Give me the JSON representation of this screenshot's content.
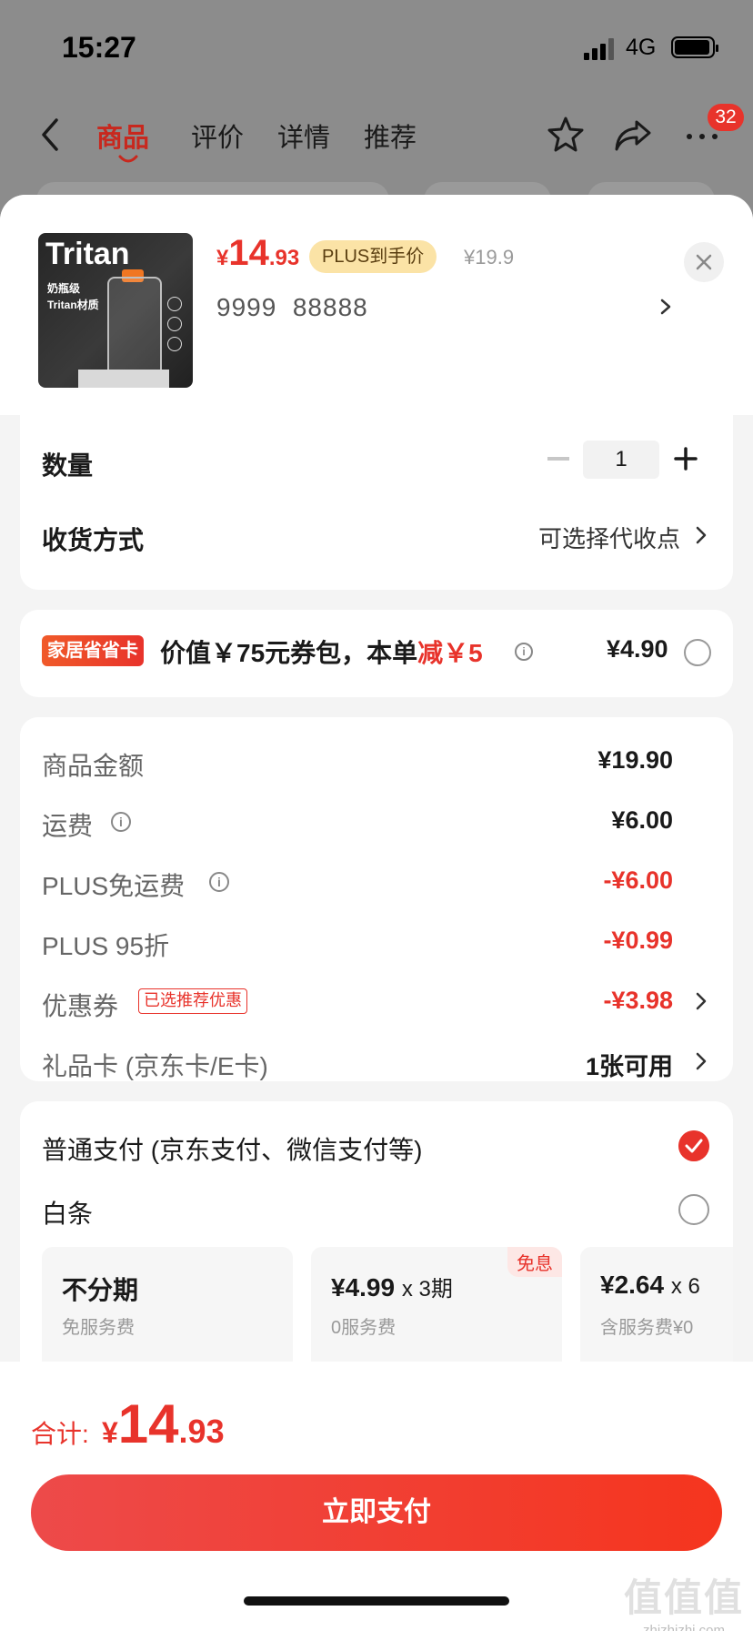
{
  "status_bar": {
    "time": "15:27",
    "network": "4G"
  },
  "nav": {
    "tabs": [
      {
        "label": "商品",
        "active": true
      },
      {
        "label": "评价",
        "active": false
      },
      {
        "label": "详情",
        "active": false
      },
      {
        "label": "推荐",
        "active": false
      }
    ],
    "icons": [
      "back-icon",
      "star-icon",
      "share-icon",
      "more-icon"
    ],
    "badge": "32"
  },
  "product": {
    "thumb_brand": "Tritan",
    "thumb_line1": "奶瓶级",
    "thumb_line2": "Tritan材质",
    "price_currency": "¥",
    "price_int": "14",
    "price_dec": ".93",
    "plus_tag": "PLUS到手价",
    "original_price": "¥19.9",
    "spec": "9999  88888"
  },
  "quantity": {
    "label": "数量",
    "value": "1"
  },
  "delivery": {
    "label": "收货方式",
    "value": "可选择代收点"
  },
  "promo": {
    "tag": "家居省省卡",
    "text_prefix": "价值￥75元券包，本单",
    "text_red": "减￥5",
    "price": "¥4.90"
  },
  "fees": [
    {
      "label": "商品金额",
      "value": "¥19.90",
      "red": false,
      "info": false,
      "arrow": false
    },
    {
      "label": "运费",
      "value": "¥6.00",
      "red": false,
      "info": true,
      "arrow": false
    },
    {
      "label": "PLUS免运费",
      "value": "-¥6.00",
      "red": true,
      "info": true,
      "arrow": false
    },
    {
      "label": "PLUS 95折",
      "value": "-¥0.99",
      "red": true,
      "info": false,
      "arrow": false
    },
    {
      "label": "优惠券",
      "value": "-¥3.98",
      "red": true,
      "info": false,
      "arrow": true,
      "tag": "已选推荐优惠"
    },
    {
      "label": "礼品卡 (京东卡/E卡)",
      "value": "1张可用",
      "red": false,
      "info": false,
      "arrow": true
    }
  ],
  "payment": {
    "normal": "普通支付 (京东支付、微信支付等)",
    "baitiao": "白条",
    "installments": [
      {
        "title": "不分期",
        "sub": "免服务费",
        "free": ""
      },
      {
        "title": "¥4.99",
        "times": "x 3期",
        "sub": "0服务费",
        "free": "免息"
      },
      {
        "title": "¥2.64",
        "times": "x 6",
        "sub": "含服务费¥0",
        "free": ""
      }
    ]
  },
  "footer": {
    "total_label": "合计:",
    "total_currency": "¥",
    "total_int": "14",
    "total_dec": ".93",
    "pay_button": "立即支付"
  },
  "watermark": {
    "big": "值值值",
    "small": "zhizhizhi.com"
  },
  "colors": {
    "accent": "#e8332b",
    "plus_gold": "#fbe3a6",
    "dim_overlay": "#8c8c8c"
  }
}
